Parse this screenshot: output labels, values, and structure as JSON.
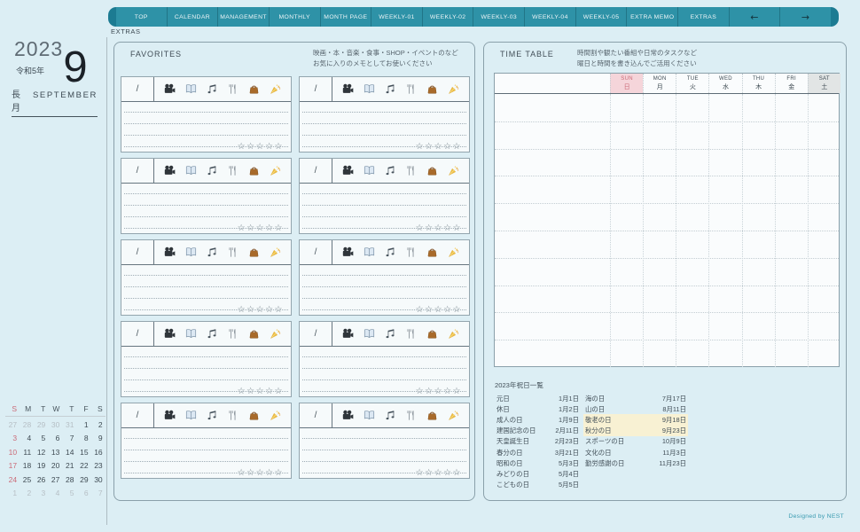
{
  "page_label": "EXTRAS",
  "colors": {
    "page_bg": "#dceef4",
    "accent": "#2e92a7",
    "accent_dark": "#1c7b92",
    "sunday_red": "#cb6b78",
    "sunday_header_bg": "#f5d5da",
    "saturday_header_bg": "#e2e5e5",
    "highlight_yellow": "#f8f1d3"
  },
  "nav": {
    "tabs": [
      "TOP",
      "CALENDAR",
      "MANAGEMENT",
      "MONTHLY",
      "MONTH PAGE",
      "WEEKLY-01",
      "WEEKLY-02",
      "WEEKLY-03",
      "WEEKLY-04",
      "WEEKLY-05",
      "EXTRA MEMO",
      "EXTRAS"
    ],
    "back_label": "←",
    "forward_label": "→"
  },
  "sidebar": {
    "year": "2023",
    "era": "令和5年",
    "month_number": "9",
    "month_jp": "長月",
    "month_en": "SEPTEMBER",
    "mini_calendar": {
      "day_headers": [
        "S",
        "M",
        "T",
        "W",
        "T",
        "F",
        "S"
      ],
      "weeks": [
        [
          {
            "d": "27",
            "out": true
          },
          {
            "d": "28",
            "out": true
          },
          {
            "d": "29",
            "out": true
          },
          {
            "d": "30",
            "out": true
          },
          {
            "d": "31",
            "out": true
          },
          {
            "d": "1"
          },
          {
            "d": "2"
          }
        ],
        [
          {
            "d": "3"
          },
          {
            "d": "4"
          },
          {
            "d": "5"
          },
          {
            "d": "6"
          },
          {
            "d": "7"
          },
          {
            "d": "8"
          },
          {
            "d": "9"
          }
        ],
        [
          {
            "d": "10"
          },
          {
            "d": "11"
          },
          {
            "d": "12"
          },
          {
            "d": "13"
          },
          {
            "d": "14"
          },
          {
            "d": "15"
          },
          {
            "d": "16"
          }
        ],
        [
          {
            "d": "17"
          },
          {
            "d": "18"
          },
          {
            "d": "19"
          },
          {
            "d": "20"
          },
          {
            "d": "21"
          },
          {
            "d": "22"
          },
          {
            "d": "23"
          }
        ],
        [
          {
            "d": "24"
          },
          {
            "d": "25"
          },
          {
            "d": "26"
          },
          {
            "d": "27"
          },
          {
            "d": "28"
          },
          {
            "d": "29"
          },
          {
            "d": "30"
          }
        ],
        [
          {
            "d": "1",
            "out": true
          },
          {
            "d": "2",
            "out": true
          },
          {
            "d": "3",
            "out": true
          },
          {
            "d": "4",
            "out": true
          },
          {
            "d": "5",
            "out": true
          },
          {
            "d": "6",
            "out": true
          },
          {
            "d": "7",
            "out": true
          }
        ]
      ]
    }
  },
  "favorites": {
    "title": "FAVORITES",
    "note_line1": "映画・本・音楽・食事・SHOP・イベントのなど",
    "note_line2": "お気に入りのメモとしてお使いください",
    "entries_count": 10,
    "date_placeholder": "/",
    "category_icons": [
      "movie-camera",
      "open-book",
      "music-notes",
      "fork-knife",
      "handbag",
      "party-popper"
    ],
    "rating_stars": "☆☆☆☆☆"
  },
  "timetable": {
    "title": "TIME TABLE",
    "note_line1": "時間割や観たい番組や日常のタスクなど",
    "note_line2": "曜日と時間を書き込んでご活用ください",
    "days": [
      {
        "en": "SUN",
        "jp": "日",
        "type": "sun"
      },
      {
        "en": "MON",
        "jp": "月",
        "type": "weekday"
      },
      {
        "en": "TUE",
        "jp": "火",
        "type": "weekday"
      },
      {
        "en": "WED",
        "jp": "水",
        "type": "weekday"
      },
      {
        "en": "THU",
        "jp": "木",
        "type": "weekday"
      },
      {
        "en": "FRI",
        "jp": "金",
        "type": "weekday"
      },
      {
        "en": "SAT",
        "jp": "土",
        "type": "sat"
      }
    ],
    "row_lines": 9
  },
  "holidays": {
    "title": "2023年祝日一覧",
    "left_column": [
      {
        "name": "元日",
        "date": "1月1日"
      },
      {
        "name": "休日",
        "date": "1月2日"
      },
      {
        "name": "成人の日",
        "date": "1月9日"
      },
      {
        "name": "建国記念の日",
        "date": "2月11日"
      },
      {
        "name": "天皇誕生日",
        "date": "2月23日"
      },
      {
        "name": "春分の日",
        "date": "3月21日"
      },
      {
        "name": "昭和の日",
        "date": "5月3日"
      },
      {
        "name": "みどりの日",
        "date": "5月4日"
      },
      {
        "name": "こどもの日",
        "date": "5月5日"
      }
    ],
    "right_column": [
      {
        "name": "海の日",
        "date": "7月17日"
      },
      {
        "name": "山の日",
        "date": "8月11日"
      },
      {
        "name": "敬老の日",
        "date": "9月18日",
        "highlight": true
      },
      {
        "name": "秋分の日",
        "date": "9月23日",
        "highlight": true
      },
      {
        "name": "スポーツの日",
        "date": "10月9日"
      },
      {
        "name": "文化の日",
        "date": "11月3日"
      },
      {
        "name": "勤労感謝の日",
        "date": "11月23日"
      }
    ]
  },
  "footer": {
    "credit": "Designed by NEST"
  }
}
